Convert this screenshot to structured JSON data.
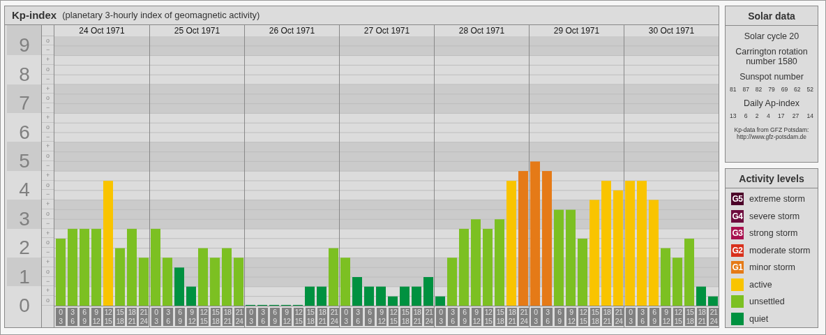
{
  "kp": {
    "title": "Kp-index",
    "subtitle": "(planetary 3-hourly index of geomagnetic activity)",
    "y_levels": [
      {
        "marks": [
          "o",
          "−"
        ]
      },
      {
        "marks": [
          "+",
          "o",
          "−"
        ]
      },
      {
        "marks": [
          "+",
          "o",
          "−"
        ]
      },
      {
        "marks": [
          "+",
          "o",
          "−"
        ]
      },
      {
        "marks": [
          "+",
          "o",
          "−"
        ]
      },
      {
        "marks": [
          "+",
          "o",
          "−"
        ]
      },
      {
        "marks": [
          "+",
          "o",
          "−"
        ]
      },
      {
        "marks": [
          "+",
          "o",
          "−"
        ]
      },
      {
        "marks": [
          "+",
          "o",
          "−"
        ]
      },
      {
        "marks": [
          "+",
          "o"
        ]
      }
    ],
    "days": [
      {
        "date": "24 Oct 1971",
        "slots": [
          {
            "from": "0",
            "to": "3"
          },
          {
            "from": "3",
            "to": "6"
          },
          {
            "from": "6",
            "to": "9"
          },
          {
            "from": "9",
            "to": "12"
          },
          {
            "from": "12",
            "to": "15"
          },
          {
            "from": "15",
            "to": "18"
          },
          {
            "from": "18",
            "to": "21"
          },
          {
            "from": "21",
            "to": "24"
          }
        ]
      },
      {
        "date": "25 Oct 1971",
        "slots": [
          {
            "from": "0",
            "to": "3"
          },
          {
            "from": "3",
            "to": "6"
          },
          {
            "from": "6",
            "to": "9"
          },
          {
            "from": "9",
            "to": "12"
          },
          {
            "from": "12",
            "to": "15"
          },
          {
            "from": "15",
            "to": "18"
          },
          {
            "from": "18",
            "to": "21"
          },
          {
            "from": "21",
            "to": "24"
          }
        ]
      },
      {
        "date": "26 Oct 1971",
        "slots": [
          {
            "from": "0",
            "to": "3"
          },
          {
            "from": "3",
            "to": "6"
          },
          {
            "from": "6",
            "to": "9"
          },
          {
            "from": "9",
            "to": "12"
          },
          {
            "from": "12",
            "to": "15"
          },
          {
            "from": "15",
            "to": "18"
          },
          {
            "from": "18",
            "to": "21"
          },
          {
            "from": "21",
            "to": "24"
          }
        ]
      },
      {
        "date": "27 Oct 1971",
        "slots": [
          {
            "from": "0",
            "to": "3"
          },
          {
            "from": "3",
            "to": "6"
          },
          {
            "from": "6",
            "to": "9"
          },
          {
            "from": "9",
            "to": "12"
          },
          {
            "from": "12",
            "to": "15"
          },
          {
            "from": "15",
            "to": "18"
          },
          {
            "from": "18",
            "to": "21"
          },
          {
            "from": "21",
            "to": "24"
          }
        ]
      },
      {
        "date": "28 Oct 1971",
        "slots": [
          {
            "from": "0",
            "to": "3"
          },
          {
            "from": "3",
            "to": "6"
          },
          {
            "from": "6",
            "to": "9"
          },
          {
            "from": "9",
            "to": "12"
          },
          {
            "from": "12",
            "to": "15"
          },
          {
            "from": "15",
            "to": "18"
          },
          {
            "from": "18",
            "to": "21"
          },
          {
            "from": "21",
            "to": "24"
          }
        ]
      },
      {
        "date": "29 Oct 1971",
        "slots": [
          {
            "from": "0",
            "to": "3"
          },
          {
            "from": "3",
            "to": "6"
          },
          {
            "from": "6",
            "to": "9"
          },
          {
            "from": "9",
            "to": "12"
          },
          {
            "from": "12",
            "to": "15"
          },
          {
            "from": "15",
            "to": "18"
          },
          {
            "from": "18",
            "to": "21"
          },
          {
            "from": "21",
            "to": "24"
          }
        ]
      },
      {
        "date": "30 Oct 1971",
        "slots": [
          {
            "from": "0",
            "to": "3"
          },
          {
            "from": "3",
            "to": "6"
          },
          {
            "from": "6",
            "to": "9"
          },
          {
            "from": "9",
            "to": "12"
          },
          {
            "from": "12",
            "to": "15"
          },
          {
            "from": "15",
            "to": "18"
          },
          {
            "from": "18",
            "to": "21"
          },
          {
            "from": "21",
            "to": "24"
          }
        ]
      }
    ],
    "chart_data": {
      "type": "bar",
      "grid": true,
      "ylim": [
        0,
        9
      ],
      "yticks": [
        {
          "value": 0,
          "label": "0"
        },
        {
          "value": 1,
          "label": "1"
        },
        {
          "value": 2,
          "label": "2"
        },
        {
          "value": 3,
          "label": "3"
        },
        {
          "value": 4,
          "label": "4"
        },
        {
          "value": 5,
          "label": "5"
        },
        {
          "value": 6,
          "label": "6"
        },
        {
          "value": 7,
          "label": "7"
        },
        {
          "value": 8,
          "label": "8"
        },
        {
          "value": 9,
          "label": "9"
        }
      ],
      "values": [
        2.33,
        2.67,
        2.67,
        2.67,
        4.33,
        2,
        2.67,
        1.67,
        2.67,
        1.67,
        1.33,
        0.67,
        2,
        1.67,
        2,
        1.67,
        0,
        0,
        0,
        0,
        0,
        0.67,
        0.67,
        2,
        1.67,
        1,
        0.67,
        0.67,
        0.33,
        0.67,
        0.67,
        1,
        0.33,
        1.67,
        2.67,
        3,
        2.67,
        3,
        4.33,
        4.67,
        5,
        4.67,
        3.33,
        3.33,
        2.33,
        3.67,
        4.33,
        4,
        4.33,
        4.33,
        3.67,
        2,
        1.67,
        2.33,
        0.67,
        0.33
      ]
    }
  },
  "solar": {
    "title": "Solar data",
    "cycle": "Solar cycle 20",
    "rotation": "Carrington rotation number 1580",
    "sunspot_title": "Sunspot number",
    "sunspots": [
      "81",
      "87",
      "82",
      "79",
      "69",
      "62",
      "52"
    ],
    "ap_title": "Daily Ap-index",
    "ap": [
      "13",
      "6",
      "2",
      "4",
      "17",
      "27",
      "14"
    ],
    "credit": "Kp-data from GFZ Potsdam:",
    "credit_url": "http://www.gfz-potsdam.de"
  },
  "legend": {
    "title": "Activity levels",
    "items": [
      {
        "badge": "G5",
        "label": "extreme storm",
        "color": "#4b0028"
      },
      {
        "badge": "G4",
        "label": "severe storm",
        "color": "#6e0c3e"
      },
      {
        "badge": "G3",
        "label": "strong storm",
        "color": "#a8104e"
      },
      {
        "badge": "G2",
        "label": "moderate storm",
        "color": "#d8301c"
      },
      {
        "badge": "G1",
        "label": "minor storm",
        "color": "#e57a17"
      },
      {
        "label": "active",
        "color": "#f9c400"
      },
      {
        "label": "unsettled",
        "color": "#7cc022"
      },
      {
        "label": "quiet",
        "color": "#009140"
      }
    ]
  }
}
